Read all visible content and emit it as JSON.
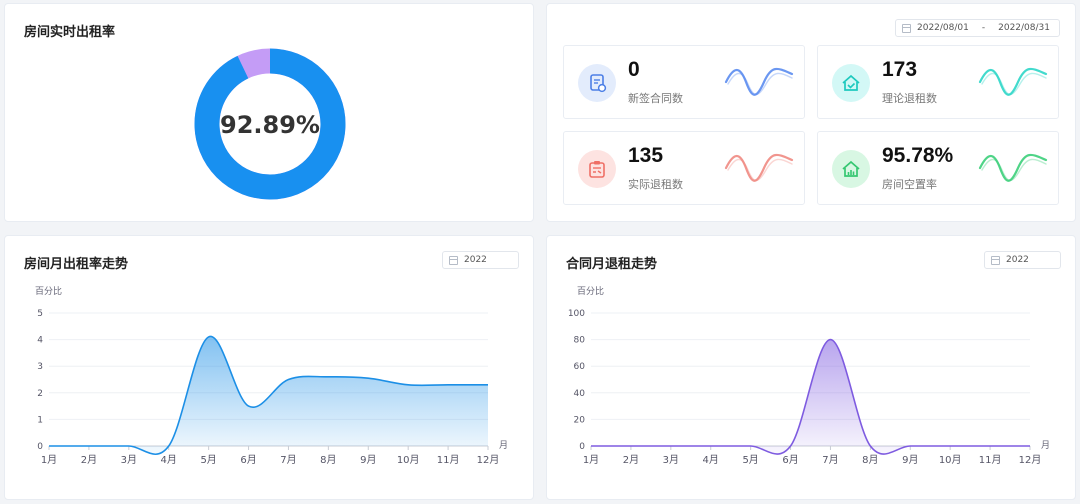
{
  "occupancy": {
    "title": "房间实时出租率",
    "rate_text": "92.89%",
    "rate_value": 92.89,
    "colors": {
      "main": "#1890f0",
      "rest": "#c49cf6"
    }
  },
  "stats": {
    "date_start": "2022/08/01",
    "date_sep": "-",
    "date_end": "2022/08/31",
    "cards": [
      {
        "value": "0",
        "label": "新签合同数",
        "icon": "contract-icon",
        "icon_bg": "#e3ecfc",
        "icon_color": "#4c7fe6",
        "wave_color": "#5b8cf0"
      },
      {
        "value": "173",
        "label": "理论退租数",
        "icon": "house-check-icon",
        "icon_bg": "#d3f8f6",
        "icon_color": "#1ec9be",
        "wave_color": "#2ed6c8"
      },
      {
        "value": "135",
        "label": "实际退租数",
        "icon": "clipboard-icon",
        "icon_bg": "#fde3e1",
        "icon_color": "#ef6f66",
        "wave_color": "#f08a82"
      },
      {
        "value": "95.78%",
        "label": "房间空置率",
        "icon": "house-chart-icon",
        "icon_bg": "#d8f7e3",
        "icon_color": "#35c771",
        "wave_color": "#3ccf7a"
      }
    ]
  },
  "left_chart": {
    "title": "房间月出租率走势",
    "year": "2022"
  },
  "right_chart": {
    "title": "合同月退租走势",
    "year": "2022"
  },
  "chart_data": [
    {
      "type": "area",
      "title": "房间月出租率走势",
      "ylabel": "百分比",
      "xunit": "月",
      "categories": [
        "1月",
        "2月",
        "3月",
        "4月",
        "5月",
        "6月",
        "7月",
        "8月",
        "9月",
        "10月",
        "11月",
        "12月"
      ],
      "series": [
        {
          "values": [
            0,
            0,
            0,
            0,
            4.1,
            1.5,
            2.5,
            2.6,
            2.55,
            2.3,
            2.3,
            2.3
          ]
        }
      ],
      "ylim": [
        0,
        5
      ],
      "yticks": [
        0,
        1,
        2,
        3,
        4,
        5
      ],
      "color": "#1c8fe6",
      "grid": true
    },
    {
      "type": "area",
      "title": "合同月退租走势",
      "ylabel": "百分比",
      "xunit": "月",
      "categories": [
        "1月",
        "2月",
        "3月",
        "4月",
        "5月",
        "6月",
        "7月",
        "8月",
        "9月",
        "10月",
        "11月",
        "12月"
      ],
      "series": [
        {
          "values": [
            0,
            0,
            0,
            0,
            0,
            0,
            80,
            0,
            0,
            0,
            0,
            0
          ]
        }
      ],
      "ylim": [
        0,
        100
      ],
      "yticks": [
        0,
        20,
        40,
        60,
        80,
        100
      ],
      "color": "#7e5be0",
      "grid": true
    }
  ]
}
